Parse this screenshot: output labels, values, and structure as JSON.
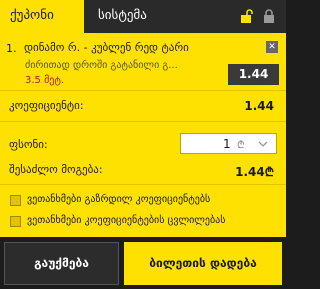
{
  "tabs": {
    "active": "ქუპონი",
    "system": "სისტემა"
  },
  "bet": {
    "number": "1.",
    "title": "დინამო რ. - კუბლენ რედ ტარი",
    "market": "ძირითად დროში გატანილი გ...",
    "stake": "3.5 მეტ.",
    "odd": "1.44"
  },
  "coefficient": {
    "label": "კოეფიციენტი:",
    "value": "1.44"
  },
  "stake_row": {
    "label": "ფსონი:",
    "value": "1",
    "currency": "₾"
  },
  "possible_win": {
    "label": "შესაძლო მოგება:",
    "value": "1.44₾"
  },
  "options": [
    {
      "label": "ვეთანხმები გაზრდილ კოეფიციენტებს"
    },
    {
      "label": "ვეთანხმები კოეფიციენტების ცვლილებას"
    }
  ],
  "buttons": {
    "cancel": "გაუქმება",
    "place": "ბილეთის დადება"
  }
}
